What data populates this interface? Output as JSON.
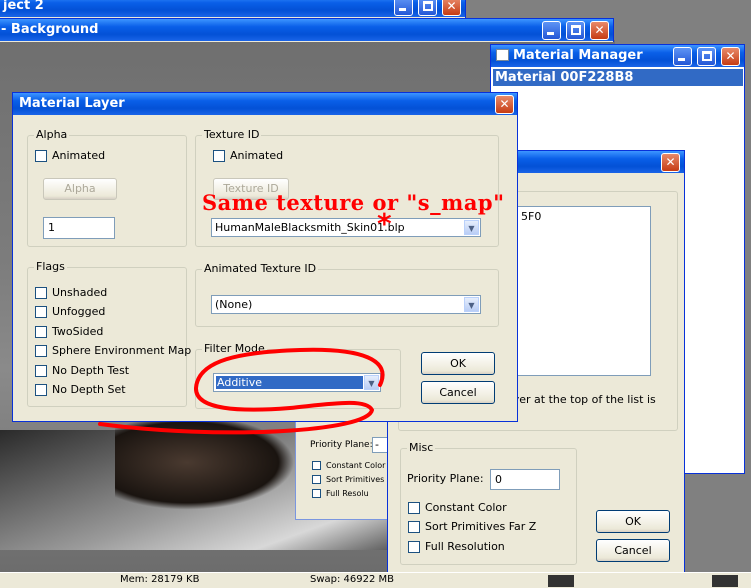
{
  "background_scene": {
    "window_title": "Background"
  },
  "project_window": {
    "title": "ject 2"
  },
  "material_manager": {
    "title": "Material Manager",
    "selected_item": "Material 00F228B8"
  },
  "layer_window": {
    "id_fragment": "5F0",
    "hint": "ayer at the top of the list is",
    "hint_end": "!",
    "misc": {
      "label": "Misc",
      "priority_plane_label": "Priority Plane:",
      "priority_plane_value": "0",
      "constant_color": "Constant Color",
      "sort_primitives": "Sort Primitives Far Z",
      "full_resolution": "Full Resolution"
    },
    "ok": "OK",
    "cancel": "Cancel"
  },
  "behind_window": {
    "priority_plane": "Priority Plane:",
    "constant_color": "Constant Color",
    "sort_primitives": "Sort Primitives Fa",
    "full_resolution": "Full Resolu"
  },
  "material_layer": {
    "title": "Material Layer",
    "alpha": {
      "label": "Alpha",
      "animated": "Animated",
      "button": "Alpha",
      "value": "1"
    },
    "texture": {
      "label": "Texture ID",
      "animated": "Animated",
      "button": "Texture ID",
      "selected": "HumanMaleBlacksmith_Skin01.blp"
    },
    "flags": {
      "label": "Flags",
      "items": [
        "Unshaded",
        "Unfogged",
        "TwoSided",
        "Sphere Environment Map",
        "No Depth Test",
        "No Depth Set"
      ]
    },
    "animated_texture": {
      "label": "Animated Texture ID",
      "selected": "(None)"
    },
    "filter_mode": {
      "label": "Filter Mode",
      "selected": "Additive"
    },
    "ok": "OK",
    "cancel": "Cancel"
  },
  "annotation": {
    "text": "Same texture or \"s_map\"",
    "color": "#ff0000"
  },
  "status": {
    "mem": "Mem: 28179 KB",
    "swap": "Swap: 46922 MB"
  }
}
